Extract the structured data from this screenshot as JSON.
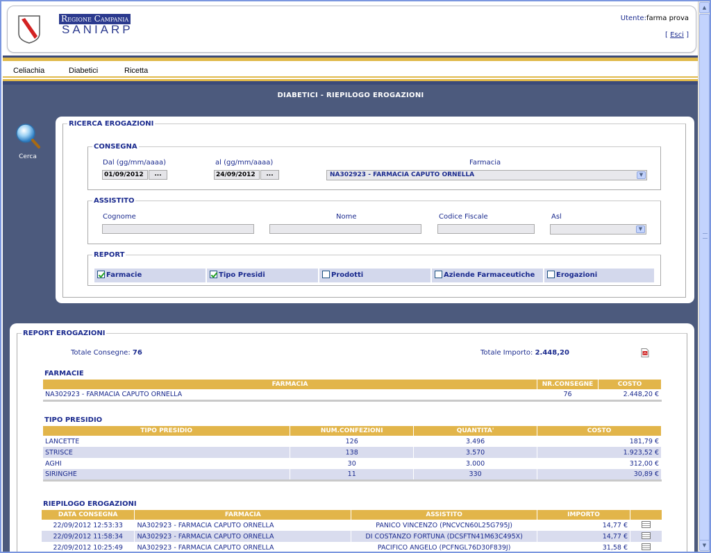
{
  "header": {
    "brand_top": "Regione Campania",
    "brand_bottom": "SANIARP",
    "user_label": "Utente:",
    "user_name": "farma prova",
    "logout_open": "[ ",
    "logout_label": "Esci",
    "logout_close": " ]"
  },
  "menu": {
    "items": [
      "Celiachia",
      "Diabetici",
      "Ricetta"
    ]
  },
  "page": {
    "title": "DIABETICI - RIEPILOGO EROGAZIONI"
  },
  "search_button": {
    "label": "Cerca",
    "icon": "magnifier-icon"
  },
  "search": {
    "legend": "RICERCA EROGAZIONI",
    "consegna": {
      "legend": "CONSEGNA",
      "from_label": "Dal  (gg/mm/aaaa)",
      "from_value": "01/09/2012",
      "to_label": "al  (gg/mm/aaaa)",
      "to_value": "24/09/2012",
      "picker_label": "...",
      "pharmacy_label": "Farmacia",
      "pharmacy_value": "NA302923 - FARMACIA CAPUTO ORNELLA"
    },
    "assistito": {
      "legend": "ASSISTITO",
      "cognome_label": "Cognome",
      "nome_label": "Nome",
      "cf_label": "Codice Fiscale",
      "asl_label": "Asl"
    },
    "report": {
      "legend": "REPORT",
      "options": [
        {
          "label": "Farmacie",
          "checked": true
        },
        {
          "label": "Tipo Presidi",
          "checked": true
        },
        {
          "label": "Prodotti",
          "checked": false
        },
        {
          "label": "Aziende Farmaceutiche",
          "checked": false
        },
        {
          "label": "Erogazioni",
          "checked": false
        }
      ]
    }
  },
  "report": {
    "legend": "REPORT EROGAZIONI",
    "total_deliveries_label": "Totale Consegne:",
    "total_deliveries": "76",
    "total_amount_label": "Totale Importo:",
    "total_amount": "2.448,20",
    "pdf_icon": "pdf-icon",
    "farmacie": {
      "title": "FARMACIE",
      "headers": [
        "FARMACIA",
        "NR.CONSEGNE",
        "COSTO"
      ],
      "rows": [
        [
          "NA302923 - FARMACIA CAPUTO ORNELLA",
          "76",
          "2.448,20 €"
        ]
      ]
    },
    "tipo_presidio": {
      "title": "TIPO PRESIDIO",
      "headers": [
        "TIPO PRESIDIO",
        "NUM.CONFEZIONI",
        "QUANTITA'",
        "COSTO"
      ],
      "rows": [
        [
          "LANCETTE",
          "126",
          "3.496",
          "181,79 €"
        ],
        [
          "STRISCE",
          "138",
          "3.570",
          "1.923,52 €"
        ],
        [
          "AGHI",
          "30",
          "3.000",
          "312,00 €"
        ],
        [
          "SIRINGHE",
          "11",
          "330",
          "30,89 €"
        ]
      ]
    },
    "riepilogo": {
      "title": "RIEPILOGO EROGAZIONI",
      "headers": [
        "DATA CONSEGNA",
        "FARMACIA",
        "ASSISTITO",
        "IMPORTO",
        ""
      ],
      "rows": [
        [
          "22/09/2012 12:53:33",
          "NA302923 - FARMACIA CAPUTO ORNELLA",
          "PANICO VINCENZO (PNCVCN60L25G795J)",
          "14,77 €"
        ],
        [
          "22/09/2012 11:58:34",
          "NA302923 - FARMACIA CAPUTO ORNELLA",
          "DI COSTANZO FORTUNA (DCSFTN41M63C495X)",
          "14,77 €"
        ],
        [
          "22/09/2012 10:25:49",
          "NA302923 - FARMACIA CAPUTO ORNELLA",
          "PACIFICO ANGELO (PCFNGL76D30F839J)",
          "31,58 €"
        ]
      ]
    }
  },
  "colors": {
    "brand_blue": "#2b3a8e",
    "panel_bg": "#4c5a7d",
    "header_gold": "#e2b54a",
    "alt_row": "#d9dcee"
  }
}
